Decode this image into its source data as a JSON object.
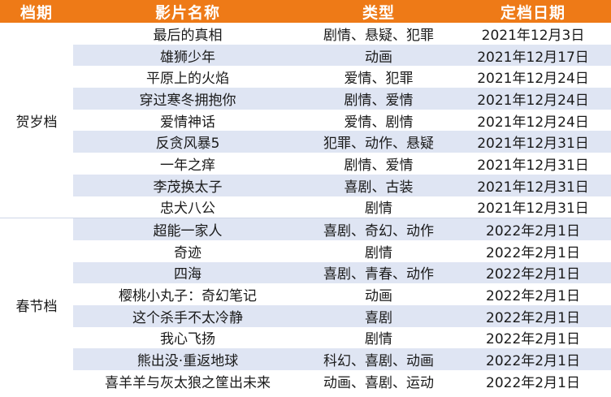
{
  "headers": {
    "period": "档期",
    "title": "影片名称",
    "genre": "类型",
    "date": "定档日期"
  },
  "colors": {
    "header_bg": "#ee7a17",
    "header_text": "#ffffff",
    "row_shade": "#dfe5f3"
  },
  "groups": [
    {
      "period": "贺岁档",
      "films": [
        {
          "title": "最后的真相",
          "genre": "剧情、悬疑、犯罪",
          "date": "2021年12月3日"
        },
        {
          "title": "雄狮少年",
          "genre": "动画",
          "date": "2021年12月17日"
        },
        {
          "title": "平原上的火焰",
          "genre": "爱情、犯罪",
          "date": "2021年12月24日"
        },
        {
          "title": "穿过寒冬拥抱你",
          "genre": "剧情、爱情",
          "date": "2021年12月24日"
        },
        {
          "title": "爱情神话",
          "genre": "爱情、剧情",
          "date": "2021年12月24日"
        },
        {
          "title": "反贪风暴5",
          "genre": "犯罪、动作、悬疑",
          "date": "2021年12月31日"
        },
        {
          "title": "一年之痒",
          "genre": "剧情、爱情",
          "date": "2021年12月31日"
        },
        {
          "title": "李茂换太子",
          "genre": "喜剧、古装",
          "date": "2021年12月31日"
        },
        {
          "title": "忠犬八公",
          "genre": "剧情",
          "date": "2021年12月31日"
        }
      ]
    },
    {
      "period": "春节档",
      "films": [
        {
          "title": "超能一家人",
          "genre": "喜剧、奇幻、动作",
          "date": "2022年2月1日"
        },
        {
          "title": "奇迹",
          "genre": "剧情",
          "date": "2022年2月1日"
        },
        {
          "title": "四海",
          "genre": "喜剧、青春、动作",
          "date": "2022年2月1日"
        },
        {
          "title": "樱桃小丸子：奇幻笔记",
          "genre": "动画",
          "date": "2022年2月1日"
        },
        {
          "title": "这个杀手不太冷静",
          "genre": "喜剧",
          "date": "2022年2月1日"
        },
        {
          "title": "我心飞扬",
          "genre": "剧情",
          "date": "2022年2月1日"
        },
        {
          "title": "熊出没·重返地球",
          "genre": "科幻、喜剧、动画",
          "date": "2022年2月1日"
        },
        {
          "title": "喜羊羊与灰太狼之筐出未来",
          "genre": "动画、喜剧、运动",
          "date": "2022年2月1日"
        }
      ]
    }
  ]
}
